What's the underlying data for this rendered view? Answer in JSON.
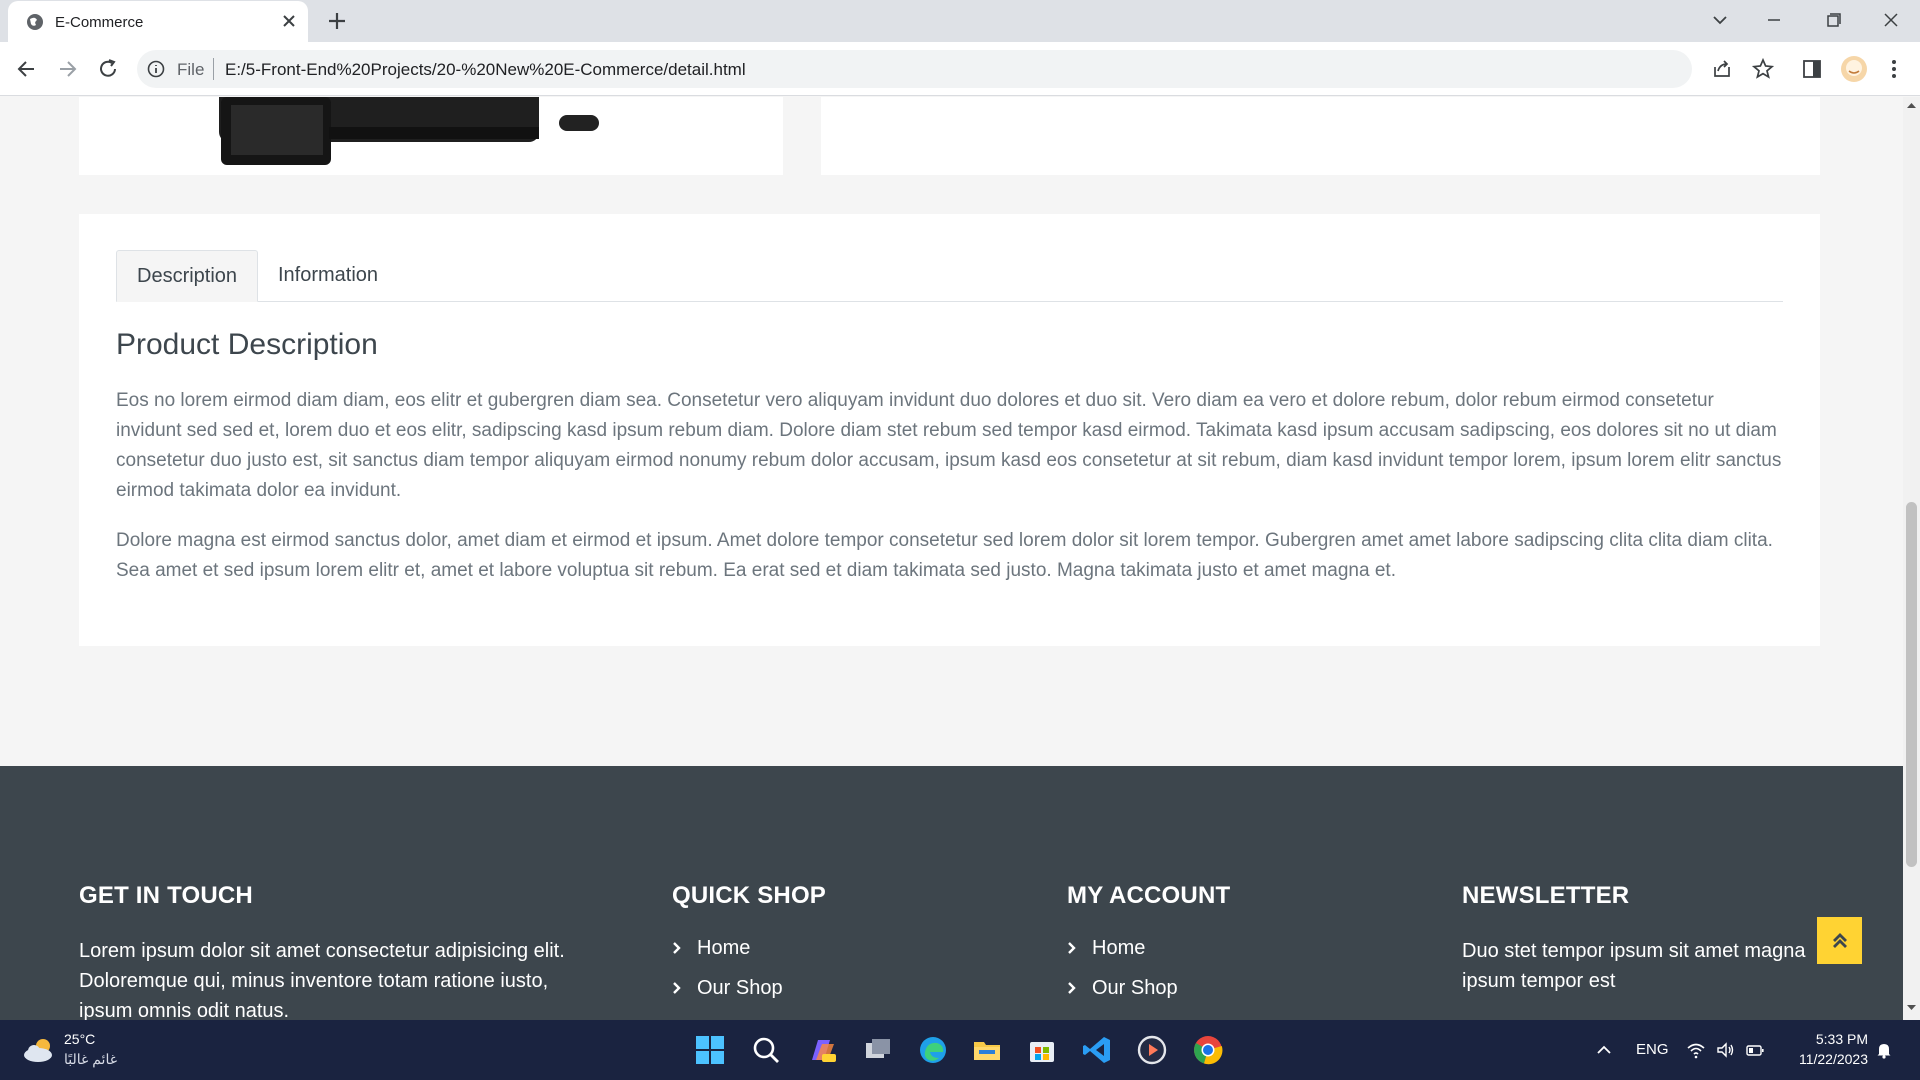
{
  "browser": {
    "tab_title": "E-Commerce",
    "url_scheme": "File",
    "url": "E:/5-Front-End%20Projects/20-%20New%20E-Commerce/detail.html"
  },
  "tabs": [
    {
      "label": "Description",
      "active": true
    },
    {
      "label": "Information",
      "active": false
    }
  ],
  "description": {
    "heading": "Product Description",
    "paragraph_1": "Eos no lorem eirmod diam diam, eos elitr et gubergren diam sea. Consetetur vero aliquyam invidunt duo dolores et duo sit. Vero diam ea vero et dolore rebum, dolor rebum eirmod consetetur invidunt sed sed et, lorem duo et eos elitr, sadipscing kasd ipsum rebum diam. Dolore diam stet rebum sed tempor kasd eirmod. Takimata kasd ipsum accusam sadipscing, eos dolores sit no ut diam consetetur duo justo est, sit sanctus diam tempor aliquyam eirmod nonumy rebum dolor accusam, ipsum kasd eos consetetur at sit rebum, diam kasd invidunt tempor lorem, ipsum lorem elitr sanctus eirmod takimata dolor ea invidunt.",
    "paragraph_2": "Dolore magna est eirmod sanctus dolor, amet diam et eirmod et ipsum. Amet dolore tempor consetetur sed lorem dolor sit lorem tempor. Gubergren amet amet labore sadipscing clita clita diam clita. Sea amet et sed ipsum lorem elitr et, amet et labore voluptua sit rebum. Ea erat sed et diam takimata sed justo. Magna takimata justo et amet magna et."
  },
  "footer": {
    "get_in_touch": {
      "heading": "GET IN TOUCH",
      "text_line_1": "Lorem ipsum dolor sit amet consectetur adipisicing elit.",
      "text_line_2": "Doloremque qui, minus inventore totam ratione iusto,",
      "text_line_3": "ipsum omnis odit natus."
    },
    "quick_shop": {
      "heading": "QUICK SHOP",
      "links": [
        "Home",
        "Our Shop"
      ]
    },
    "my_account": {
      "heading": "MY ACCOUNT",
      "links": [
        "Home",
        "Our Shop"
      ]
    },
    "newsletter": {
      "heading": "NEWSLETTER",
      "text_line_1": "Duo stet tempor ipsum sit amet magna",
      "text_line_2": "ipsum tempor est"
    }
  },
  "taskbar": {
    "temperature": "25°C",
    "weather": "غائم غالبًا",
    "language": "ENG",
    "time": "5:33 PM",
    "date": "11/22/2023"
  },
  "colors": {
    "accent": "#ffd333",
    "footer_bg": "#3d464d",
    "page_bg": "#f5f5f5",
    "taskbar_bg": "#1a2340"
  }
}
